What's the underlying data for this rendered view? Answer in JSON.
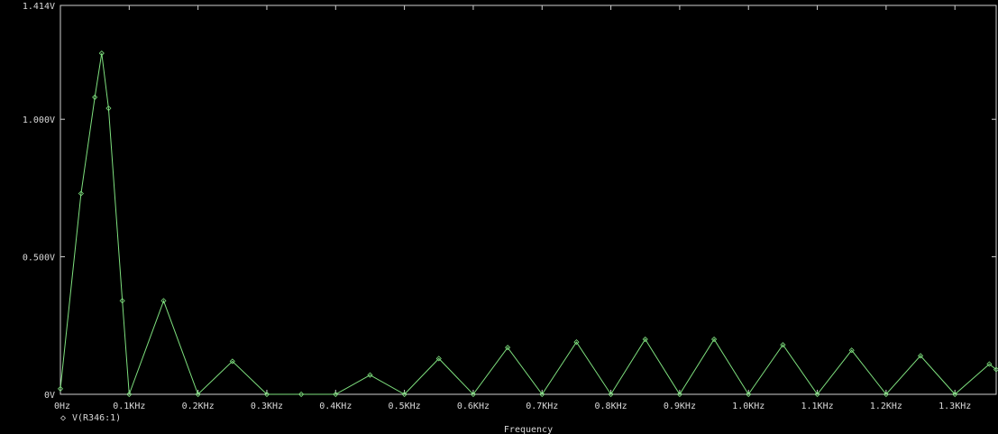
{
  "chart_data": {
    "type": "line",
    "title": "",
    "xlabel": "Frequency",
    "ylabel": "",
    "xlim": [
      0,
      1.36
    ],
    "ylim": [
      0,
      1.414
    ],
    "x_ticks": [
      {
        "value": 0.0,
        "label": "0Hz"
      },
      {
        "value": 0.1,
        "label": "0.1KHz"
      },
      {
        "value": 0.2,
        "label": "0.2KHz"
      },
      {
        "value": 0.3,
        "label": "0.3KHz"
      },
      {
        "value": 0.4,
        "label": "0.4KHz"
      },
      {
        "value": 0.5,
        "label": "0.5KHz"
      },
      {
        "value": 0.6,
        "label": "0.6KHz"
      },
      {
        "value": 0.7,
        "label": "0.7KHz"
      },
      {
        "value": 0.8,
        "label": "0.8KHz"
      },
      {
        "value": 0.9,
        "label": "0.9KHz"
      },
      {
        "value": 1.0,
        "label": "1.0KHz"
      },
      {
        "value": 1.1,
        "label": "1.1KHz"
      },
      {
        "value": 1.2,
        "label": "1.2KHz"
      },
      {
        "value": 1.3,
        "label": "1.3KHz"
      }
    ],
    "y_ticks": [
      {
        "value": 0,
        "label": "0V"
      },
      {
        "value": 0.5,
        "label": "0.500V"
      },
      {
        "value": 1.0,
        "label": "1.000V"
      },
      {
        "value": 1.414,
        "label": "1.414V"
      }
    ],
    "grid": false,
    "legend_position": "bottom-left",
    "colors": {
      "background": "#000000",
      "axes": "#d0d0d0",
      "trace": "#7ee07e"
    },
    "series": [
      {
        "name": "V(R346:1)",
        "marker": "◇",
        "x": [
          0.0,
          0.03,
          0.05,
          0.06,
          0.07,
          0.09,
          0.1,
          0.15,
          0.2,
          0.25,
          0.3,
          0.35,
          0.4,
          0.45,
          0.5,
          0.55,
          0.6,
          0.65,
          0.7,
          0.75,
          0.8,
          0.85,
          0.9,
          0.95,
          1.0,
          1.05,
          1.1,
          1.15,
          1.2,
          1.25,
          1.3,
          1.35,
          1.36
        ],
        "y": [
          0.02,
          0.73,
          1.08,
          1.24,
          1.04,
          0.34,
          0.0,
          0.34,
          0.0,
          0.12,
          0.0,
          0.0,
          0.0,
          0.07,
          0.0,
          0.13,
          0.0,
          0.17,
          0.0,
          0.19,
          0.0,
          0.2,
          0.0,
          0.2,
          0.0,
          0.18,
          0.0,
          0.16,
          0.0,
          0.14,
          0.0,
          0.11,
          0.09
        ]
      }
    ]
  }
}
